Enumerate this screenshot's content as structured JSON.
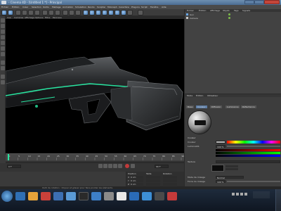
{
  "window": {
    "title": "- Cinema 4D - [Untitled 1 *] - Principal"
  },
  "menu": [
    "Fichier",
    "Édition",
    "Créer",
    "Sélection",
    "Outils",
    "Maillage",
    "Animation",
    "Simulation",
    "Rendu",
    "Sculpter",
    "MoGraph",
    "Caractère",
    "Plug-ins",
    "Script",
    "Fenêtre",
    "Aide"
  ],
  "viewport": {
    "menu": [
      "Vue",
      "Caméras",
      "Affichage",
      "Options",
      "Filtre",
      "Panneau"
    ]
  },
  "object_manager": {
    "tabs": [
      "Fichier",
      "Édition",
      "Affichage",
      "Objets",
      "Tags",
      "Signets"
    ],
    "objects": [
      {
        "name": "Gun"
      },
      {
        "name": "Camera"
      }
    ]
  },
  "attribute_manager": {
    "tabs": [
      "Mode",
      "Édition",
      "Utilisateur"
    ],
    "material_tabs": [
      "Base",
      "Couleur",
      "Diffusion",
      "Luminance",
      "Réflectance"
    ],
    "section_title": "Couleur",
    "rows": [
      {
        "label": "Couleur"
      },
      {
        "label": "Luminosité",
        "value": "100 %"
      },
      {
        "label": "Texture"
      },
      {
        "label": "Mode de mixage",
        "value": "Normal"
      },
      {
        "label": "Force du mixage",
        "value": "100 %"
      }
    ]
  },
  "timeline": {
    "ticks": [
      "0",
      "5",
      "10",
      "15",
      "20",
      "25",
      "30",
      "35",
      "40",
      "45",
      "50",
      "55",
      "60",
      "65",
      "70",
      "75",
      "80",
      "85",
      "90"
    ],
    "current_frame": "0 F",
    "end_frame": "90 F"
  },
  "coordinates": {
    "headers": [
      "Position",
      "Taille",
      "Rotation"
    ],
    "labels": [
      "X",
      "Y",
      "Z"
    ],
    "values": [
      "0 cm",
      "0 cm",
      "0 cm"
    ],
    "apply_label": "Appliquer"
  },
  "status": {
    "text": "Outil de rotation : Cliquer et glisser pour faire pivoter les éléments."
  },
  "colors": {
    "accent": "#29e4a0",
    "title_bar": "#4f7196",
    "viewport_bg": "#000000"
  }
}
